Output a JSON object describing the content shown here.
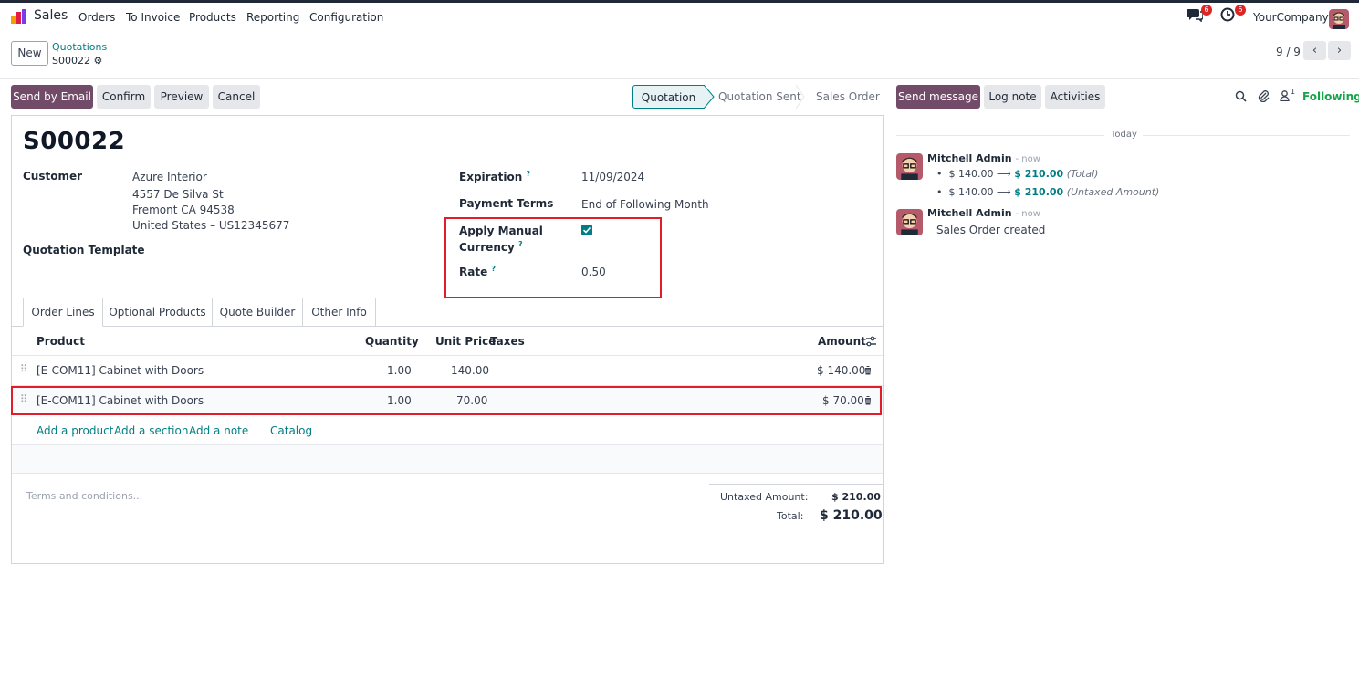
{
  "navbar": {
    "app_name": "Sales",
    "menu": [
      "Orders",
      "To Invoice",
      "Products",
      "Reporting",
      "Configuration"
    ],
    "messages_badge": "6",
    "activities_badge": "5",
    "company": "YourCompany"
  },
  "control_panel": {
    "new_label": "New",
    "breadcrumb_parent": "Quotations",
    "breadcrumb_current": "S00022",
    "pager": "9 / 9"
  },
  "statusbar": {
    "buttons": [
      "Send by Email",
      "Confirm",
      "Preview",
      "Cancel"
    ],
    "stages": [
      "Quotation",
      "Quotation Sent",
      "Sales Order"
    ],
    "active_stage": "Quotation"
  },
  "form": {
    "name": "S00022",
    "customer_label": "Customer",
    "customer": {
      "name": "Azure Interior",
      "street": "4557 De Silva St",
      "city": "Fremont CA 94538",
      "country": "United States – US12345677"
    },
    "template_label": "Quotation Template",
    "expiration_label": "Expiration",
    "expiration": "11/09/2024",
    "payment_terms_label": "Payment Terms",
    "payment_terms": "End of Following Month",
    "manual_currency_label_1": "Apply Manual",
    "manual_currency_label_2": "Currency",
    "manual_currency_checked": true,
    "rate_label": "Rate",
    "rate": "0.50"
  },
  "tabs": [
    "Order Lines",
    "Optional Products",
    "Quote Builder",
    "Other Info"
  ],
  "order_lines": {
    "headers": {
      "product": "Product",
      "quantity": "Quantity",
      "unit_price": "Unit Price",
      "taxes": "Taxes",
      "amount": "Amount"
    },
    "rows": [
      {
        "product": "[E-COM11] Cabinet with Doors",
        "quantity": "1.00",
        "unit_price": "140.00",
        "taxes": "",
        "amount": "$ 140.00"
      },
      {
        "product": "[E-COM11] Cabinet with Doors",
        "quantity": "1.00",
        "unit_price": "70.00",
        "taxes": "",
        "amount": "$ 70.00"
      }
    ],
    "actions": [
      "Add a product",
      "Add a section",
      "Add a note",
      "Catalog"
    ]
  },
  "totals": {
    "terms_placeholder": "Terms and conditions...",
    "untaxed_label": "Untaxed Amount:",
    "untaxed": "$ 210.00",
    "total_label": "Total:",
    "total": "$ 210.00"
  },
  "chatter": {
    "send_message": "Send message",
    "log_note": "Log note",
    "activities": "Activities",
    "followers_count": "1",
    "following": "Following",
    "date_separator": "Today",
    "messages": [
      {
        "author": "Mitchell Admin",
        "time": "- now",
        "tracking": [
          {
            "old": "$ 140.00",
            "new": "$ 210.00",
            "field": "(Total)"
          },
          {
            "old": "$ 140.00",
            "new": "$ 210.00",
            "field": "(Untaxed Amount)"
          }
        ]
      },
      {
        "author": "Mitchell Admin",
        "time": "- now",
        "body": "Sales Order created"
      }
    ]
  },
  "colors": {
    "brand": "#714b67",
    "accent": "#017e84",
    "highlight": "#e11d2a"
  }
}
